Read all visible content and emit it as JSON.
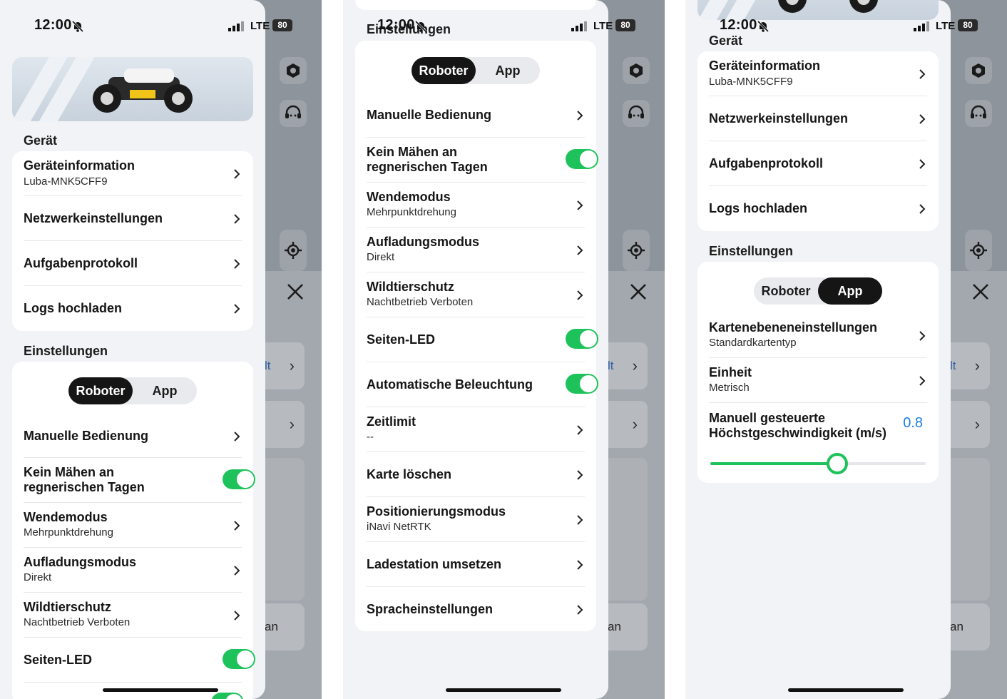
{
  "status": {
    "time": "12:00",
    "network": "LTE",
    "battery": "80"
  },
  "bg": {
    "card1_text": "lt",
    "card3_text": "an"
  },
  "screen1": {
    "device_section": "Gerät",
    "device_rows": [
      {
        "title": "Geräteinformation",
        "sub": "Luba-MNK5CFF9"
      },
      {
        "title": "Netzwerkeinstellungen"
      },
      {
        "title": "Aufgabenprotokoll"
      },
      {
        "title": "Logs hochladen"
      }
    ],
    "settings_section": "Einstellungen",
    "segment": {
      "robot": "Roboter",
      "app": "App",
      "active": "robot"
    },
    "settings_rows": [
      {
        "title": "Manuelle Bedienung"
      },
      {
        "title": "Kein Mähen an regnerischen Tagen",
        "toggle": true
      },
      {
        "title": "Wendemodus",
        "sub": "Mehrpunktdrehung"
      },
      {
        "title": "Aufladungsmodus",
        "sub": "Direkt"
      },
      {
        "title": "Wildtierschutz",
        "sub": "Nachtbetrieb Verboten"
      },
      {
        "title": "Seiten-LED",
        "toggle": true
      }
    ]
  },
  "screen2": {
    "header": "Einstellungen",
    "segment": {
      "robot": "Roboter",
      "app": "App",
      "active": "robot"
    },
    "rows": [
      {
        "title": "Manuelle Bedienung"
      },
      {
        "title": "Kein Mähen an regnerischen Tagen",
        "toggle": true
      },
      {
        "title": "Wendemodus",
        "sub": "Mehrpunktdrehung"
      },
      {
        "title": "Aufladungsmodus",
        "sub": "Direkt"
      },
      {
        "title": "Wildtierschutz",
        "sub": "Nachtbetrieb Verboten"
      },
      {
        "title": "Seiten-LED",
        "toggle": true
      },
      {
        "title": "Automatische Beleuchtung",
        "toggle": true
      },
      {
        "title": "Zeitlimit",
        "sub": "--"
      },
      {
        "title": "Karte löschen"
      },
      {
        "title": "Positionierungsmodus",
        "sub": "iNavi NetRTK"
      },
      {
        "title": "Ladestation umsetzen"
      },
      {
        "title": "Spracheinstellungen"
      }
    ]
  },
  "screen3": {
    "device_section": "Gerät",
    "device_rows": [
      {
        "title": "Geräteinformation",
        "sub": "Luba-MNK5CFF9"
      },
      {
        "title": "Netzwerkeinstellungen"
      },
      {
        "title": "Aufgabenprotokoll"
      },
      {
        "title": "Logs hochladen"
      }
    ],
    "settings_section": "Einstellungen",
    "segment": {
      "robot": "Roboter",
      "app": "App",
      "active": "app"
    },
    "rows": [
      {
        "title": "Kartenebeneneinstellungen",
        "sub": "Standardkartentyp"
      },
      {
        "title": "Einheit",
        "sub": "Metrisch"
      }
    ],
    "speed": {
      "label": "Manuell gesteuerte Höchstgeschwindigkeit (m/s)",
      "value": "0.8",
      "fraction": 0.59
    }
  }
}
